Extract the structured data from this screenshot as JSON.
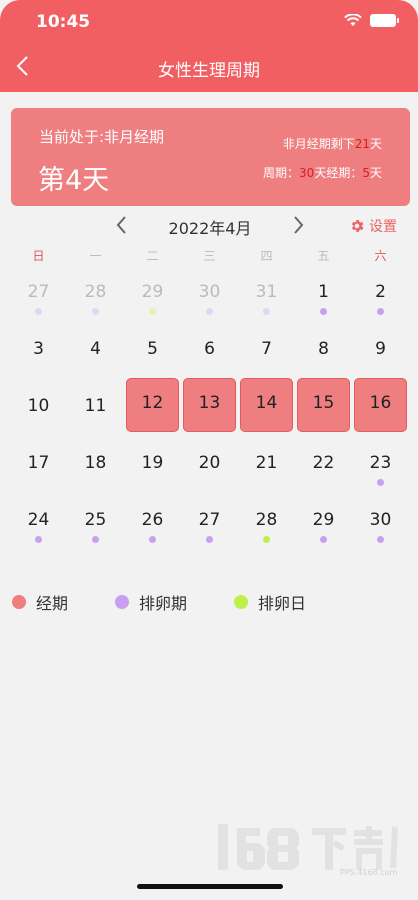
{
  "status_bar": {
    "time": "10:45"
  },
  "nav": {
    "title": "女性生理周期"
  },
  "summary": {
    "phase": "当前处于:非月经期",
    "day": "第4天",
    "remain_prefix": "非月经期剩下",
    "remain_days": "21",
    "remain_suffix": "天",
    "cycle_prefix": "周期：",
    "cycle_days": "30",
    "cycle_mid": "天经期：",
    "period_days": "5",
    "cycle_suffix": "天"
  },
  "calendar": {
    "month_label": "2022年4月",
    "settings_label": "设置",
    "weekdays": [
      "日",
      "一",
      "二",
      "三",
      "四",
      "五",
      "六"
    ],
    "weeks": [
      [
        {
          "d": "27",
          "other": true,
          "dot": "other-purple"
        },
        {
          "d": "28",
          "other": true,
          "dot": "other-purple"
        },
        {
          "d": "29",
          "other": true,
          "dot": "other-green"
        },
        {
          "d": "30",
          "other": true,
          "dot": "other-purple"
        },
        {
          "d": "31",
          "other": true,
          "dot": "other-purple"
        },
        {
          "d": "1",
          "dot": "purple"
        },
        {
          "d": "2",
          "dot": "purple"
        }
      ],
      [
        {
          "d": "3"
        },
        {
          "d": "4"
        },
        {
          "d": "5"
        },
        {
          "d": "6"
        },
        {
          "d": "7"
        },
        {
          "d": "8"
        },
        {
          "d": "9"
        }
      ],
      [
        {
          "d": "10"
        },
        {
          "d": "11"
        },
        {
          "d": "12",
          "period": true
        },
        {
          "d": "13",
          "period": true
        },
        {
          "d": "14",
          "period": true
        },
        {
          "d": "15",
          "period": true
        },
        {
          "d": "16",
          "period": true
        }
      ],
      [
        {
          "d": "17"
        },
        {
          "d": "18"
        },
        {
          "d": "19"
        },
        {
          "d": "20"
        },
        {
          "d": "21"
        },
        {
          "d": "22"
        },
        {
          "d": "23",
          "dot": "purple"
        }
      ],
      [
        {
          "d": "24",
          "dot": "purple"
        },
        {
          "d": "25",
          "dot": "purple"
        },
        {
          "d": "26",
          "dot": "purple"
        },
        {
          "d": "27",
          "dot": "purple"
        },
        {
          "d": "28",
          "dot": "green"
        },
        {
          "d": "29",
          "dot": "purple"
        },
        {
          "d": "30",
          "dot": "purple"
        }
      ]
    ]
  },
  "legend": [
    {
      "label": "经期",
      "color": "#ee7e80"
    },
    {
      "label": "排卵期",
      "color": "#c8a0f0"
    },
    {
      "label": "排卵日",
      "color": "#bff04a"
    }
  ],
  "colors": {
    "purple": "#c8a0f0",
    "green": "#bff04a",
    "other-purple": "#e3d6f2",
    "other-green": "#e3f3b4",
    "accent": "#f25f63"
  },
  "watermark": {
    "url": "PPS.4168.com"
  }
}
